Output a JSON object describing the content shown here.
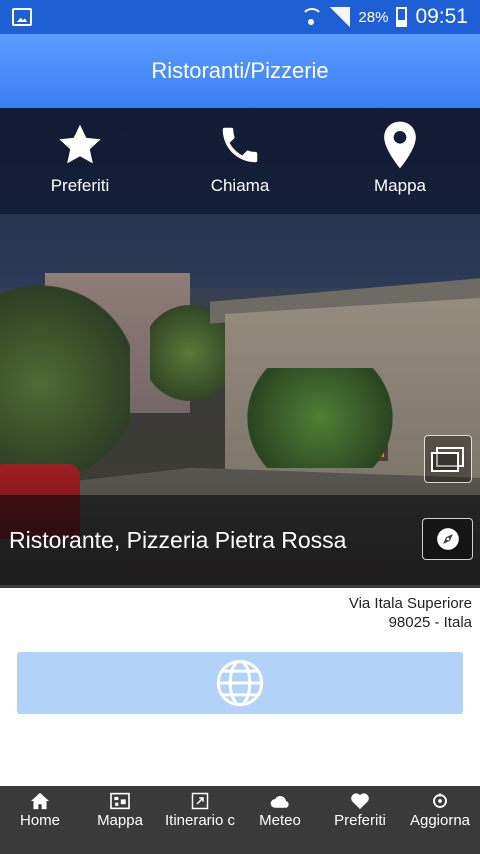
{
  "status_bar": {
    "battery": "28%",
    "time": "09:51"
  },
  "app_bar": {
    "title": "Ristoranti/Pizzerie"
  },
  "actions": [
    {
      "icon": "star-icon",
      "label": "Preferiti"
    },
    {
      "icon": "phone-icon",
      "label": "Chiama"
    },
    {
      "icon": "map-pin-icon",
      "label": "Mappa"
    }
  ],
  "place": {
    "name": "Ristorante, Pizzeria Pietra Rossa",
    "address_line1": "Via Itala Superiore",
    "address_line2": "98025 - Itala"
  },
  "bottom_nav": [
    {
      "icon": "home-icon",
      "label": "Home"
    },
    {
      "icon": "map-icon",
      "label": "Mappa"
    },
    {
      "icon": "directions-icon",
      "label": "Itinerario c"
    },
    {
      "icon": "weather-icon",
      "label": "Meteo"
    },
    {
      "icon": "heart-icon",
      "label": "Preferiti"
    },
    {
      "icon": "refresh-icon",
      "label": "Aggiorna"
    }
  ],
  "colors": {
    "status_bar": "#1f5fd6",
    "app_bar": "#4a8ff8",
    "web_button": "#b3d2f7",
    "bottom_nav": "#3a3a3a"
  }
}
